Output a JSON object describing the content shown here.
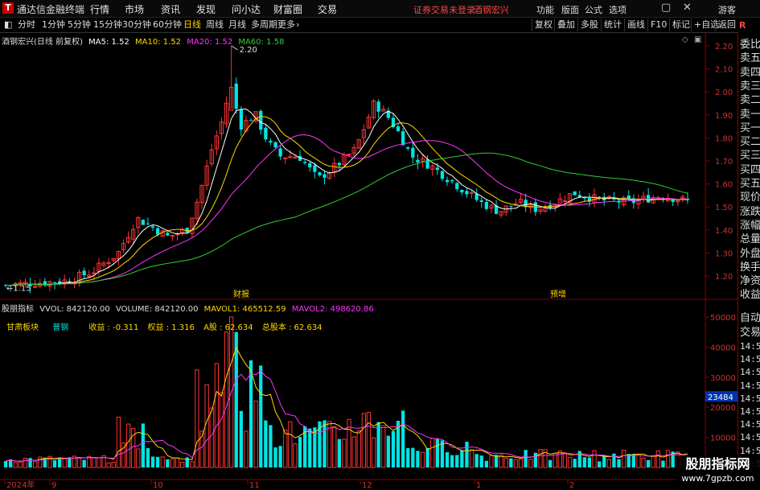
{
  "app": {
    "title": "通达信金融终端",
    "logo_text": "T",
    "login_notice": "证券交易未登录",
    "stock_name_header": "酒钢宏兴",
    "guest_label": "游客"
  },
  "menu": [
    "行情",
    "市场",
    "资讯",
    "发现",
    "问小达",
    "财富圈",
    "交易"
  ],
  "top_right_menu": [
    "功能",
    "版面",
    "公式",
    "选项"
  ],
  "periods": [
    "分时",
    "1分钟",
    "5分钟",
    "15分钟",
    "30分钟",
    "60分钟",
    "日线",
    "周线",
    "月线",
    "多周期",
    "更多"
  ],
  "active_period": "日线",
  "toolbar_right": [
    "复权",
    "叠加",
    "多股",
    "统计",
    "画线",
    "F10",
    "标记",
    "+自选",
    "返回"
  ],
  "main_chart": {
    "title": "酒钢宏兴(日线 前复权)",
    "ma_labels": [
      "MA5: 1.52",
      "MA10: 1.52",
      "MA20: 1.52",
      "MA60: 1.58"
    ],
    "ma_colors": [
      "#ffffff",
      "#ffd700",
      "#ff33ff",
      "#33cc33"
    ],
    "high_marker": "2.20",
    "low_marker": "1.15",
    "events": [
      "财报",
      "预增"
    ],
    "y_ticks": [
      "2.20",
      "2.10",
      "2.00",
      "1.90",
      "1.80",
      "1.70",
      "1.60",
      "1.50",
      "1.40",
      "1.30",
      "1.20"
    ]
  },
  "sub_chart": {
    "title": "股朋指标",
    "values": [
      "VVOL: 842120.00",
      "VOLUME: 842120.00",
      "MAVOL1: 465512.59",
      "MAVOL2: 498620.86"
    ],
    "value_colors": [
      "#dddddd",
      "#dddddd",
      "#ffd700",
      "#ff33ff"
    ],
    "info_row": [
      "甘肃板块",
      "普钢",
      "收益 : -0.311",
      "权益 : 1.316",
      "A股 : 62.634",
      "总股本 : 62.634"
    ],
    "y_ticks": [
      "50000",
      "40000",
      "30000",
      "20000",
      "10000"
    ],
    "highlight_tick": "23484"
  },
  "x_axis": {
    "labels": [
      "2024年",
      "9",
      "10",
      "11",
      "12",
      "1",
      "2"
    ]
  },
  "right_panel": {
    "top_labels": [
      "委比",
      "卖五",
      "卖四",
      "卖三",
      "卖二",
      "卖一",
      "买一",
      "买二",
      "买三",
      "买四",
      "买五",
      "现价",
      "涨跌",
      "涨幅",
      "总量",
      "外盘",
      "换手",
      "净资",
      "收益"
    ],
    "bottom_labels": [
      "自动",
      "交易"
    ],
    "times": [
      "14:56",
      "14:56",
      "14:56",
      "14:56",
      "14:56",
      "14:56",
      "14:56",
      "14:56",
      "14:56",
      "14:56"
    ]
  },
  "watermark": {
    "line1": "股朋指标网",
    "line2": "www.7gpzb.com"
  }
}
